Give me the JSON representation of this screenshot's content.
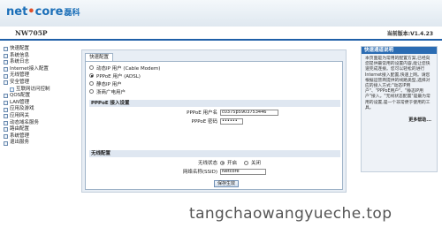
{
  "brand": {
    "logo_main": "net",
    "logo_dot": "•",
    "logo_tail": "core",
    "logo_cn": "磊科"
  },
  "header": {
    "model": "NW705P",
    "version": "当前版本:V1.4.23"
  },
  "sidebar": {
    "items": [
      {
        "label": "快速配置"
      },
      {
        "label": "系统信息"
      },
      {
        "label": "系统日志"
      },
      {
        "label": "Internet接入配置"
      },
      {
        "label": "无线管理"
      },
      {
        "label": "安全管理"
      },
      {
        "label": "互联网访问控制",
        "sub": true
      },
      {
        "label": "QOS配置"
      },
      {
        "label": "LAN管理"
      },
      {
        "label": "应用及游戏"
      },
      {
        "label": "应用网关"
      },
      {
        "label": "动态域名服务"
      },
      {
        "label": "路由配置"
      },
      {
        "label": "系统管理"
      },
      {
        "label": "退出服务"
      }
    ]
  },
  "main": {
    "tab": "快速配置",
    "wan_types": [
      {
        "label": "动态IP 用户 (Cable Modem)",
        "selected": false
      },
      {
        "label": "PPPoE 用户 (ADSL)",
        "selected": true
      },
      {
        "label": "静态IP 用户",
        "selected": false
      },
      {
        "label": "浙商广电用户",
        "selected": false
      }
    ],
    "pppoe": {
      "title": "PPPoE 接入设置",
      "username_label": "PPPoE 用户名",
      "username_value": "c0375p5903753446",
      "password_label": "PPPoE 密码",
      "password_value": "••••••"
    },
    "wireless": {
      "title": "无线配置",
      "status_label": "无线状态",
      "on_label": "开启",
      "off_label": "关闭",
      "on_selected": true,
      "ssid_label": "网络名称(SSID)",
      "ssid_value": "Netcore"
    },
    "save_label": "保存生效"
  },
  "help": {
    "title": "快速通道说明",
    "body": "本页面是为常用的配置方案,已经向您提供最常用的设置内容,能让您快速完成连接。您可以轻松的进行Internet接入配置,快速上网。请您根据运营商提供的线路类型,选择对应的接入方式:\"动态IP用户\"、\"PPPoE用户\"、\"静态IP用户\"接入。\"无线状态配置\"是最为常用的设置,是一个非常便于使用的工具。",
    "more": "更多帮助..."
  },
  "watermark": "tangchaowangyueche.top"
}
